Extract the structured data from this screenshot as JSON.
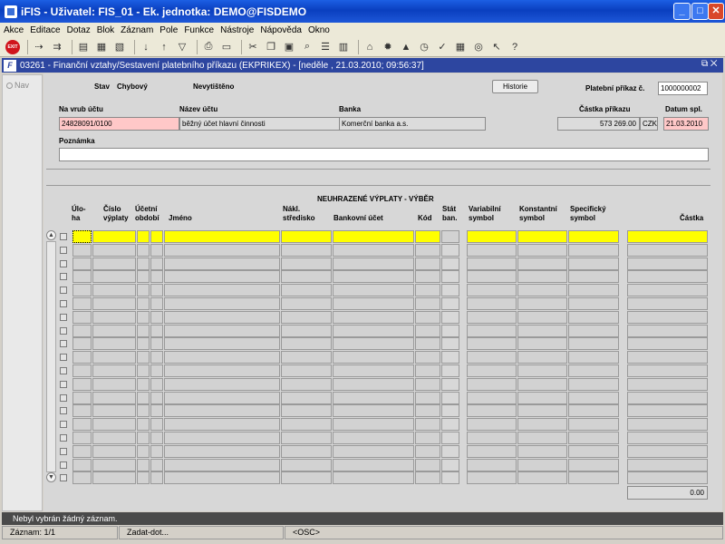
{
  "window": {
    "title": "iFIS - Uživatel: FIS_01 - Ek. jednotka: DEMO@FISDEMO",
    "min": "_",
    "max": "□",
    "close": "✕"
  },
  "menu": [
    "Akce",
    "Editace",
    "Dotaz",
    "Blok",
    "Záznam",
    "Pole",
    "Funkce",
    "Nástroje",
    "Nápověda",
    "Okno"
  ],
  "toolbar": {
    "exit_label": "EXIT"
  },
  "form_window": {
    "icon_letter": "F",
    "title": "03261 - Finanční vztahy/Sestavení platebního příkazu (EKPRIKEX) - [neděle , 21.03.2010; 09:56:37]",
    "ctl": "⧉ ✕"
  },
  "nav": {
    "label": "Nav"
  },
  "header": {
    "stav_label": "Stav",
    "stav_value": "Chybový",
    "print_value": "Nevytištěno",
    "historie_button": "Historie",
    "prikaz_label": "Platební příkaz č.",
    "prikaz_value": "1000000002",
    "vrub_label": "Na vrub účtu",
    "vrub_value": "24828091/0100",
    "nazev_label": "Název účtu",
    "nazev_value": "běžný účet hlavní činnosti",
    "banka_label": "Banka",
    "banka_value": "Komerční banka a.s.",
    "castka_label": "Částka příkazu",
    "castka_value": "573 269.00",
    "mena_value": "CZK",
    "datum_label": "Datum spl.",
    "datum_value": "21.03.2010",
    "poznamka_label": "Poznámka",
    "poznamka_value": ""
  },
  "grid": {
    "title": "NEUHRAZENÉ VÝPLATY - VÝBĚR",
    "columns": {
      "uloha": "Úlo-\nha",
      "cislo": "Číslo\nvýplaty",
      "ucetni": "Účetní\nobdobí",
      "jmeno": "Jméno",
      "nakl": "Nákl.\nstředisko",
      "bank": "Bankovní účet",
      "kod": "Kód",
      "stat": "Stát\nban.",
      "var": "Variabilní\nsymbol",
      "konst": "Konstantní\nsymbol",
      "spec": "Specifický\nsymbol",
      "castka": "Částka"
    },
    "row_count": 19,
    "total": "0.00"
  },
  "status": {
    "message": "Nebyl vybrán žádný záznam.",
    "record": "Záznam: 1/1",
    "mode": "Zadat-dot...",
    "osc": "<OSC>"
  }
}
